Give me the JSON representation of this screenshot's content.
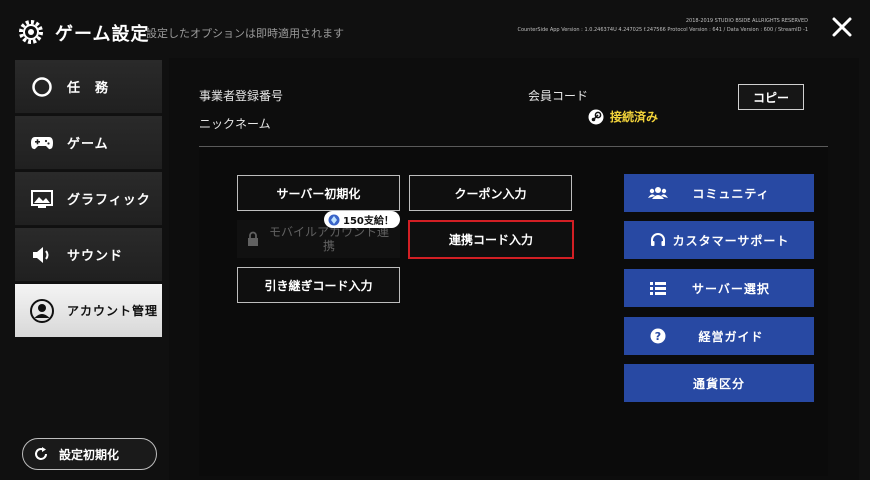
{
  "header": {
    "title": "ゲーム設定",
    "subtitle": "設定したオプションは即時適用されます",
    "copyright": "2018-2019 STUDIO BSIDE ALLRIGHTS RESERVED",
    "version": "CounterSide App Version : 1.0.246374U 4.247025 f.247566 Protocol Version : 641 / Data Version : 600 / StreamID -1"
  },
  "sidebar": {
    "items": [
      {
        "label": "任　務",
        "icon": "circle-icon"
      },
      {
        "label": "ゲーム",
        "icon": "gamepad-icon"
      },
      {
        "label": "グラフィック",
        "icon": "image-icon"
      },
      {
        "label": "サウンド",
        "icon": "speaker-icon"
      },
      {
        "label": "アカウント管理",
        "icon": "user-icon",
        "active": true
      }
    ],
    "reset_label": "設定初期化"
  },
  "account": {
    "business_number_label": "事業者登録番号",
    "nickname_label": "ニックネーム",
    "member_code_label": "会員コード",
    "copy_label": "コピー",
    "connected_label": "接続済み"
  },
  "buttons": {
    "server_reset": "サーバー初期化",
    "coupon": "クーポン入力",
    "mobile_link": "モバイルアカウント連携",
    "badge": "150支給！",
    "link_code": "連携コード入力",
    "transfer_code": "引き継ぎコード入力"
  },
  "links": [
    {
      "label": "コミュニティ",
      "icon": "people-icon"
    },
    {
      "label": "カスタマーサポート",
      "icon": "headset-icon"
    },
    {
      "label": "サーバー選択",
      "icon": "list-icon"
    },
    {
      "label": "経営ガイド",
      "icon": "help-icon"
    },
    {
      "label": "通貨区分",
      "icon": ""
    }
  ],
  "colors": {
    "accent_blue": "#2849a3",
    "highlight_red": "#d21f24",
    "connected_yellow": "#f2d33a"
  }
}
